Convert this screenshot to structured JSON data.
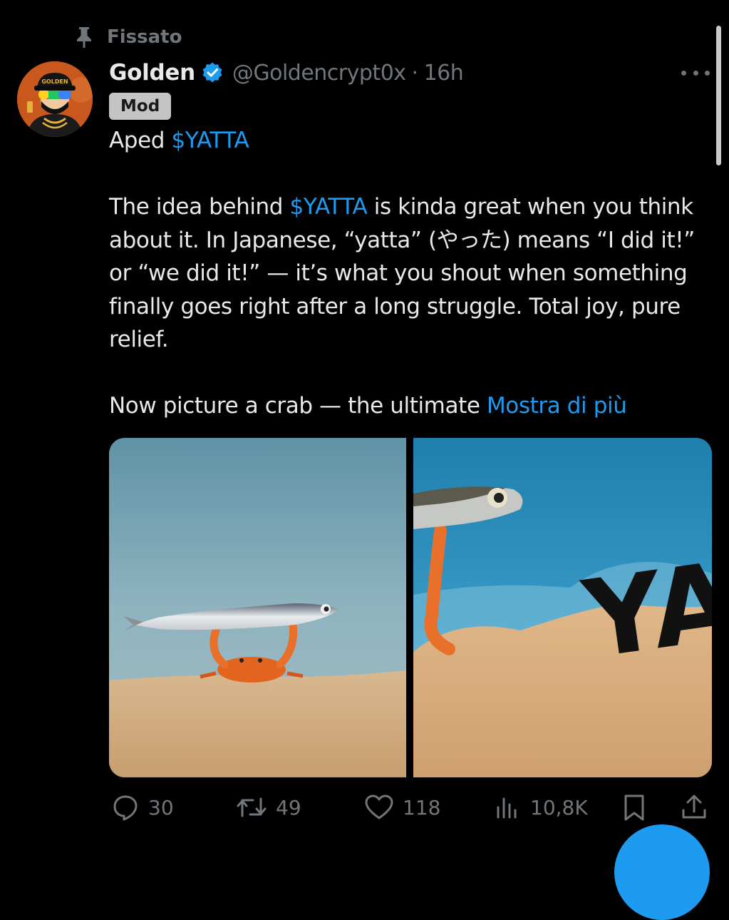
{
  "pinned": {
    "label": "Fissato"
  },
  "author": {
    "display_name": "Golden",
    "handle": "@Goldencrypt0x",
    "separator": "·",
    "time": "16h",
    "badge": "Mod",
    "avatar_cap_text": "GOLDEN"
  },
  "tweet": {
    "line1_prefix": "Aped ",
    "line1_tag": "$YATTA",
    "para1_prefix": "The idea behind ",
    "para1_tag": "$YATTA",
    "para1_rest": " is kinda great when you think about it. In Japanese, “yatta” (やった) means “I did it!” or “we did it!” — it’s what you shout when something finally goes right after a long struggle. Total joy, pure relief.",
    "para2_text": "Now picture a crab — the ultimate ",
    "show_more": "Mostra di più"
  },
  "media": {
    "right_overlay_text": "YA"
  },
  "actions": {
    "replies": "30",
    "reposts": "49",
    "likes": "118",
    "views": "10,8K"
  },
  "colors": {
    "background": "#000000",
    "text": "#e7e9ea",
    "muted": "#71767b",
    "accent": "#1d9bf0",
    "badge_bg": "#c4c4c4"
  },
  "icons": {
    "pin": "pin-icon",
    "verified": "verified-badge-icon",
    "more": "more-icon",
    "reply": "reply-icon",
    "repost": "repost-icon",
    "like": "heart-icon",
    "views": "views-icon",
    "bookmark": "bookmark-icon",
    "share": "share-icon"
  }
}
